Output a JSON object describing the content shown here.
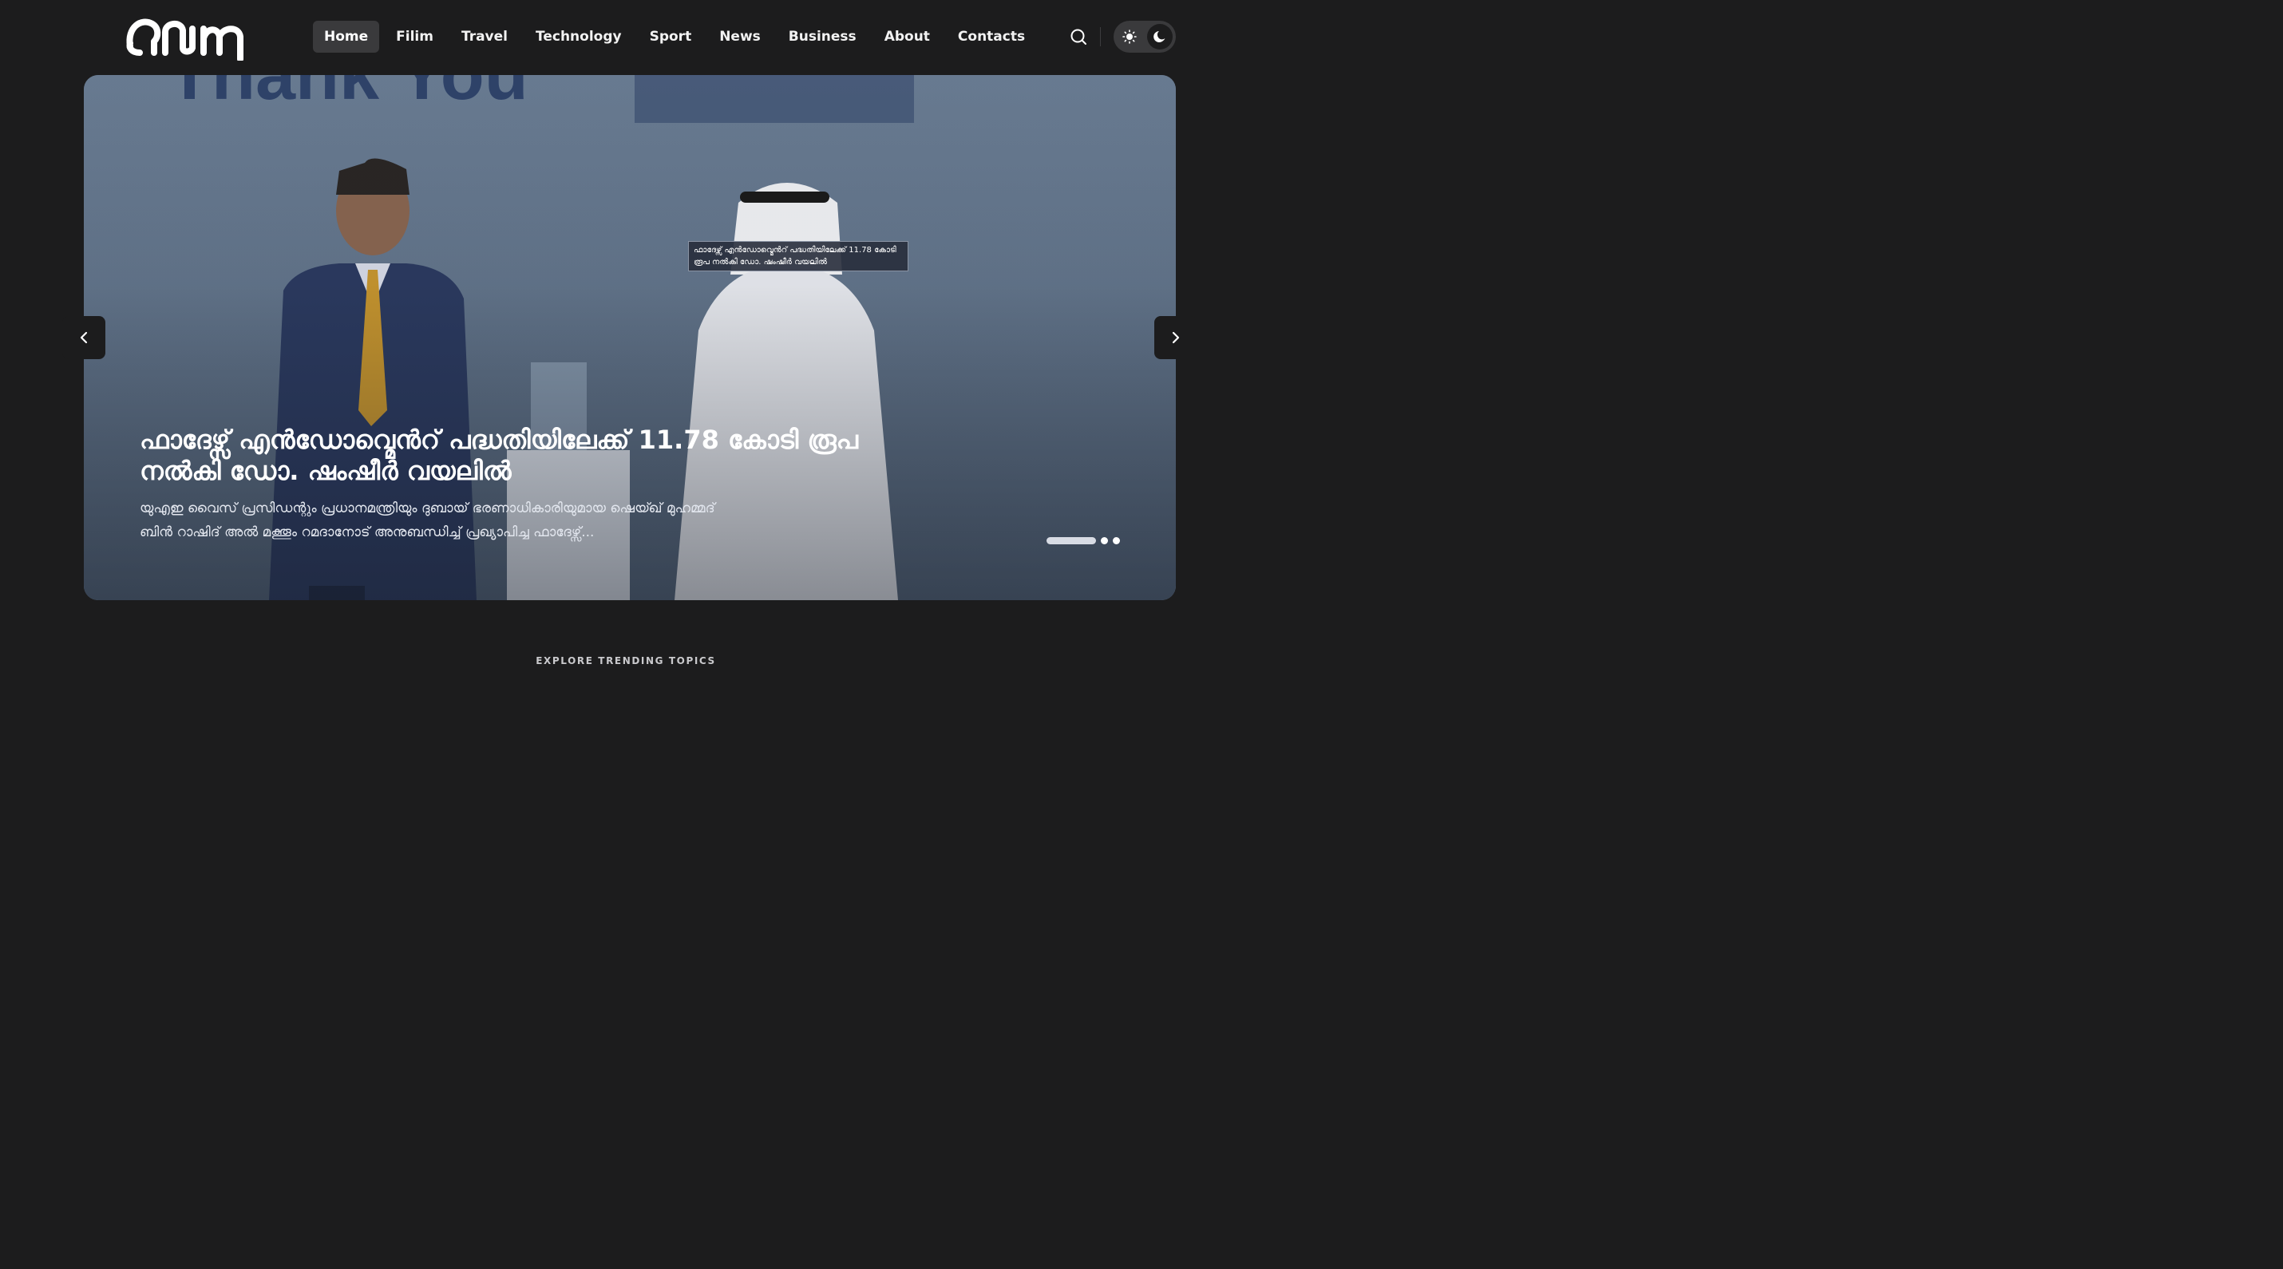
{
  "site": {
    "logo_alt": "ഡയന"
  },
  "nav": {
    "items": [
      {
        "label": "Home",
        "active": true
      },
      {
        "label": "Filim"
      },
      {
        "label": "Travel"
      },
      {
        "label": "Technology"
      },
      {
        "label": "Sport"
      },
      {
        "label": "News"
      },
      {
        "label": "Business"
      },
      {
        "label": "About"
      },
      {
        "label": "Contacts"
      }
    ]
  },
  "header": {
    "search_icon": "search-icon",
    "theme": {
      "light_icon": "sun-icon",
      "dark_icon": "moon-icon",
      "selected": "dark"
    }
  },
  "hero": {
    "image_caption": "ഫാദേഴ്സ് എൻഡോവ്മെൻറ് പദ്ധതിയിലേക്ക് 11.78 കോടി രൂപ നൽകി ഡോ. ഷംഷീർ വയലിൽ",
    "title": "ഫാദേഴ്സ് എൻഡോവ്മെൻറ് പദ്ധതിയിലേക്ക് 11.78 കോടി രൂപ നൽകി ഡോ. ഷംഷീർ വയലിൽ",
    "excerpt": "യുഎഇ വൈസ് പ്രസിഡന്റും പ്രധാനമന്ത്രിയും ദുബായ് ഭരണാധികാരിയുമായ ഷെയ്ഖ് മുഹമ്മദ് ബിൻ റാഷിദ് അൽ മക്തൂം റമദാനോട് അനുബന്ധിച്ച് പ്രഖ്യാപിച്ച ഫാദേഴ്സ്...",
    "backdrop_text": "Thank You",
    "slides_total": 3,
    "slide_active": 1
  },
  "controls": {
    "prev_icon": "chevron-left-icon",
    "next_icon": "chevron-right-icon"
  },
  "section": {
    "trending_label": "EXPLORE TRENDING TOPICS"
  },
  "colors": {
    "page_bg": "#1c1c1d",
    "pill_bg": "#3a3a3c",
    "hero_tint": "#5b6e84"
  }
}
